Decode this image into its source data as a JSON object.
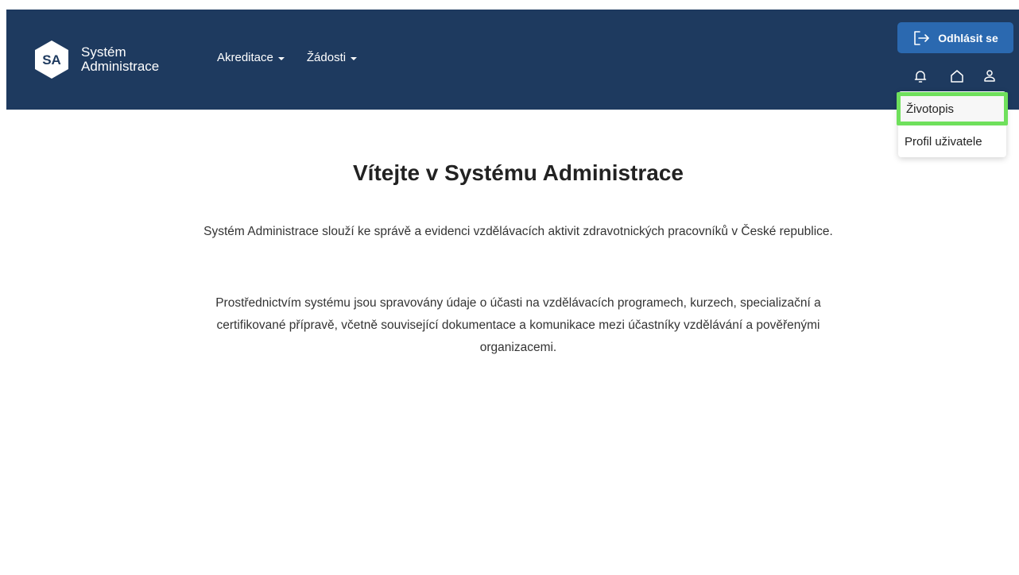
{
  "header": {
    "logo_initials": "SA",
    "logo_line1": "Systém",
    "logo_line2": "Administrace",
    "nav": [
      {
        "label": "Akreditace"
      },
      {
        "label": "Žádosti"
      }
    ],
    "logout_label": "Odhlásit se",
    "icons": [
      "bell-icon",
      "home-icon",
      "user-icon"
    ]
  },
  "dropdown": {
    "items": [
      {
        "label": "Životopis",
        "highlighted": true
      },
      {
        "label": "Profil uživatele"
      }
    ]
  },
  "main": {
    "title": "Vítejte v Systému Administrace",
    "paragraph1": "Systém Administrace slouží ke správě a evidenci vzdělávacích aktivit zdravotnických pracovníků v České republice.",
    "paragraph2": "Prostřednictvím systému jsou spravovány údaje o účasti na vzdělávacích programech, kurzech, specializační a certifikované přípravě, včetně související dokumentace a komunikace mezi účastníky vzdělávání a pověřenými organizacemi."
  },
  "colors": {
    "header_bg": "#1e3a5f",
    "logout_bg": "#2b69b0",
    "highlight_border": "#6fe05c"
  }
}
